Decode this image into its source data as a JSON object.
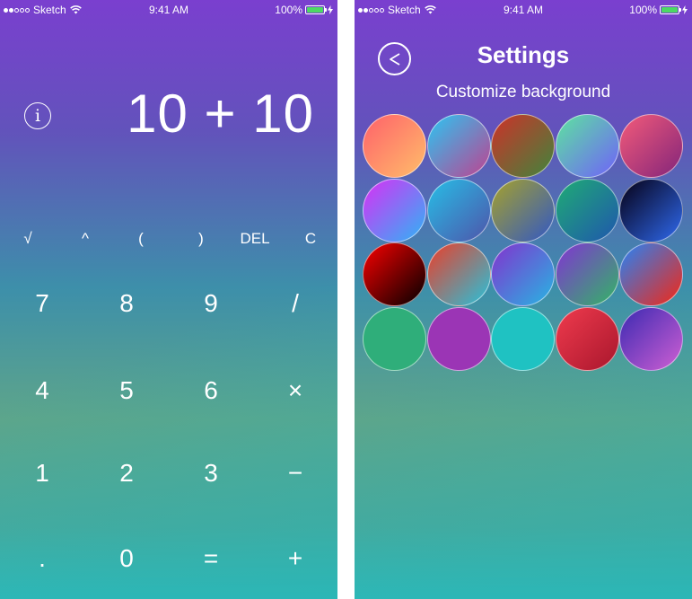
{
  "status_bar": {
    "carrier": "Sketch",
    "time": "9:41 AM",
    "battery": "100%",
    "battery_level": 1.0
  },
  "calculator": {
    "info_icon": "i",
    "display": "10 + 10",
    "function_keys": [
      "√",
      "^",
      "(",
      ")",
      "DEL",
      "C"
    ],
    "rows": [
      [
        "7",
        "8",
        "9",
        "/"
      ],
      [
        "4",
        "5",
        "6",
        "×"
      ],
      [
        "1",
        "2",
        "3",
        "−"
      ],
      [
        ".",
        "0",
        "=",
        "+"
      ]
    ]
  },
  "settings": {
    "back_icon": "<",
    "title": "Settings",
    "subtitle": "Customize background",
    "swatches": [
      [
        "#ff6a6a",
        "#ffb46a"
      ],
      [
        "#3ab8e8",
        "#b04f9a"
      ],
      [
        "#c0392b",
        "#4e7d3a"
      ],
      [
        "#5fd6a8",
        "#6e6ef0"
      ],
      [
        "#e8557a",
        "#8e2a7a"
      ],
      [
        "#c83cf5",
        "#3fa7f5"
      ],
      [
        "#2bb3e0",
        "#4a5fb0"
      ],
      [
        "#9a9a3a",
        "#3d5fb5"
      ],
      [
        "#1fa37a",
        "#1f5fa8"
      ],
      [
        "#0a0a2a",
        "#2b5fd9"
      ],
      [
        "#e00000",
        "#1a0000"
      ],
      [
        "#d94a3a",
        "#3ab5c9"
      ],
      [
        "#7a3fd0",
        "#30a8e0"
      ],
      [
        "#7a40c8",
        "#3aa870"
      ],
      [
        "#3a7ae0",
        "#e0302a"
      ],
      [
        "#2fae7a",
        "#2fae7a"
      ],
      [
        "#9b35b5",
        "#9b35b5"
      ],
      [
        "#1fc2c2",
        "#1fc2c2"
      ],
      [
        "#e8374a",
        "#b01a30"
      ],
      [
        "#4a2fb5",
        "#c05ad0"
      ]
    ]
  }
}
